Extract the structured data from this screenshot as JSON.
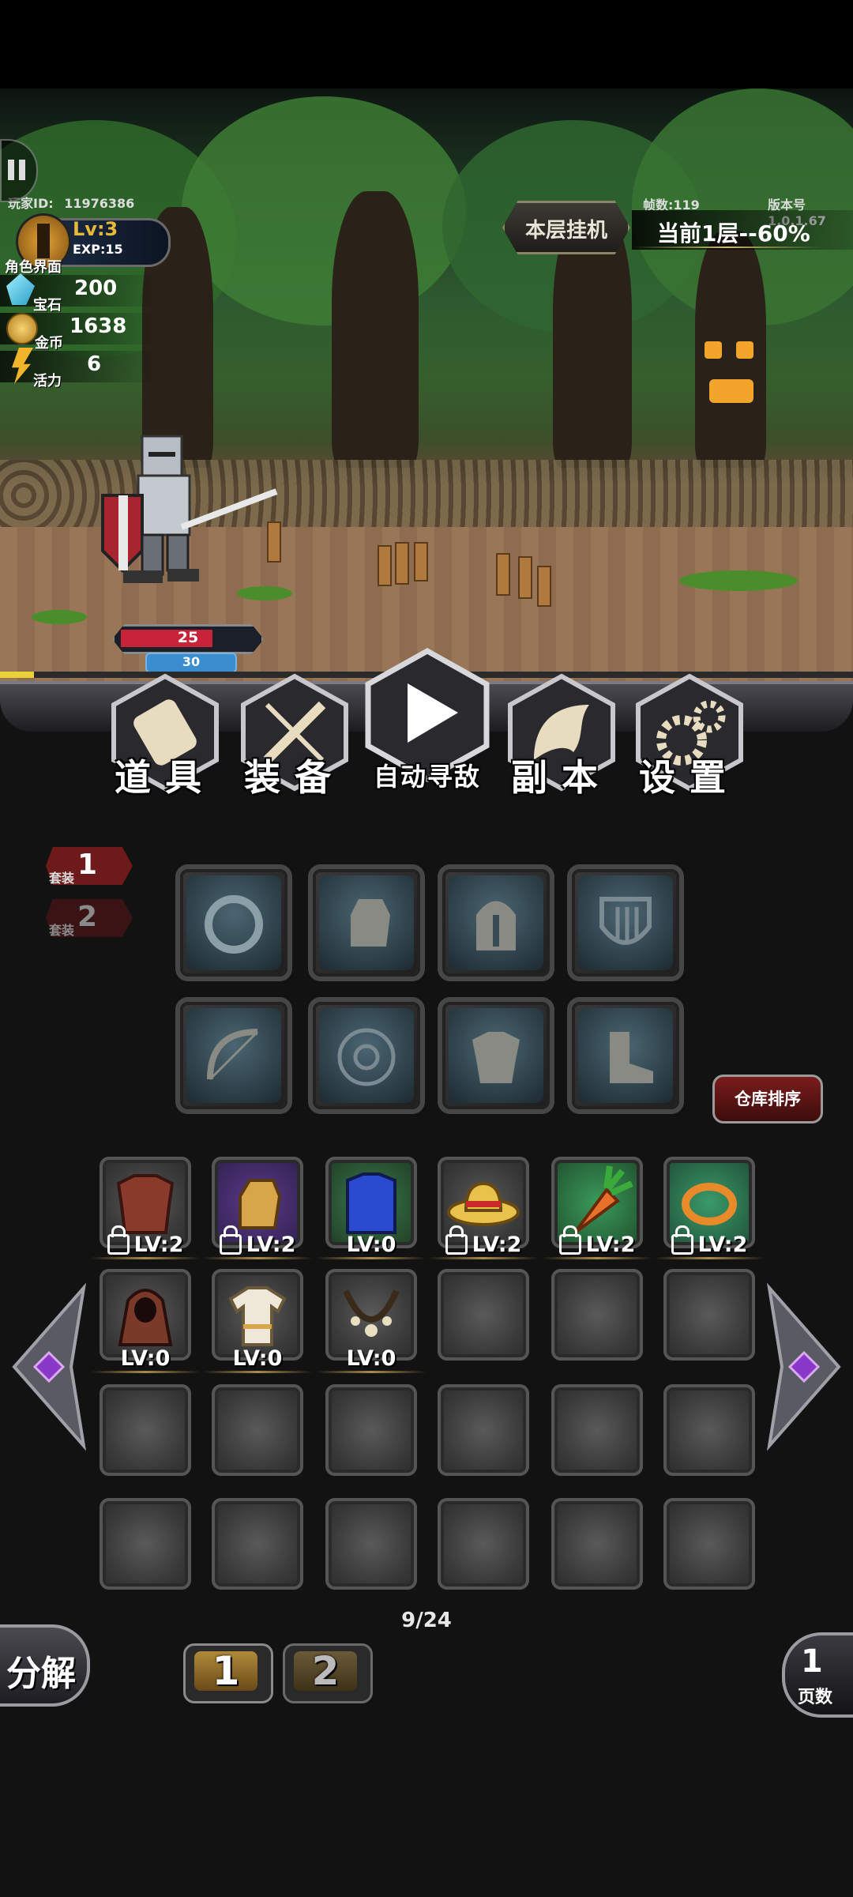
{
  "hud": {
    "player_id_label": "玩家ID:",
    "player_id": "11976386",
    "level": "Lv:3",
    "exp": "EXP:15",
    "character_label": "角色界面",
    "gem_label": "宝石",
    "gem_value": "200",
    "gold_label": "金币",
    "gold_value": "1638",
    "energy_label": "活力",
    "energy_value": "6",
    "fps": "帧数:119",
    "version": "版本号1.0.1.67",
    "idle_button": "本层挂机",
    "floor_status": "当前1层--60%"
  },
  "battle": {
    "hp": "25",
    "mp": "30",
    "hp_fraction": 0.7,
    "wave_progress": 0.04
  },
  "menu": {
    "items_label": "道具",
    "equip_label": "装备",
    "auto_label": "自动寻敌",
    "dungeon_label": "副本",
    "settings_label": "设置"
  },
  "suits": {
    "suit_word": "套装",
    "suit1": "1",
    "suit2": "2"
  },
  "equipment_slots": [
    "ring",
    "gloves",
    "helmet",
    "shield",
    "bow",
    "amulet",
    "armor",
    "boots"
  ],
  "warehouse_sort": "仓库排序",
  "inventory": [
    {
      "icon": "leather-armor",
      "level": "LV:2",
      "locked": true
    },
    {
      "icon": "gloves",
      "level": "LV:2",
      "locked": true
    },
    {
      "icon": "blue-vest",
      "level": "LV:0",
      "locked": false
    },
    {
      "icon": "straw-hat",
      "level": "LV:2",
      "locked": true
    },
    {
      "icon": "carrot",
      "level": "LV:2",
      "locked": true
    },
    {
      "icon": "ring",
      "level": "LV:2",
      "locked": true
    },
    {
      "icon": "brown-hood",
      "level": "LV:0",
      "locked": false
    },
    {
      "icon": "white-robe",
      "level": "LV:0",
      "locked": false
    },
    {
      "icon": "necklace",
      "level": "LV:0",
      "locked": false
    }
  ],
  "capacity": "9/24",
  "decompose": "分解",
  "pages": [
    "1",
    "2"
  ],
  "page_number": "1",
  "page_label": "页数",
  "colors": {
    "gold": "#e8b83a",
    "hp_red": "#c9233a",
    "mp_blue": "#3a8ed0",
    "suit_red": "#6e1a1a"
  }
}
